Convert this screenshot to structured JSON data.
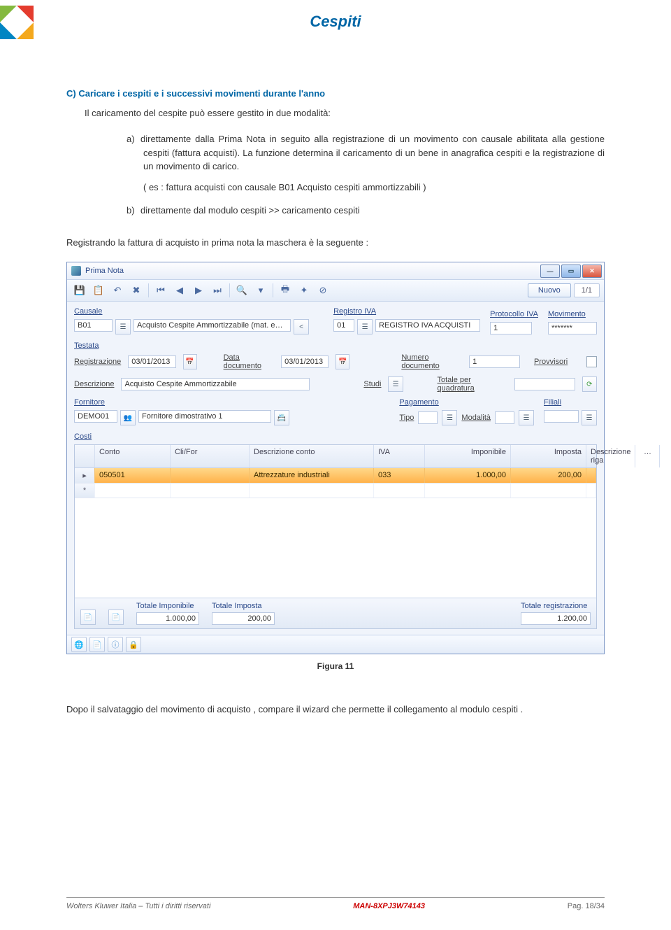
{
  "header": {
    "title": "Cespiti"
  },
  "sectionC": {
    "heading": "C)  Caricare i cespiti e i successivi movimenti durante l'anno",
    "intro": "Il caricamento del cespite può essere gestito in due modalità:"
  },
  "optA": {
    "tag": "a)",
    "text": "direttamente dalla Prima Nota in seguito alla registrazione di un movimento con causale abilitata alla gestione cespiti (fattura acquisti). La funzione determina il caricamento di un bene in anagrafica cespiti e la registrazione di un movimento di carico.",
    "example": "( es : fattura acquisti con causale B01 Acquisto cespiti ammortizzabili )"
  },
  "optB": {
    "tag": "b)",
    "text": "direttamente dal modulo cespiti >> caricamento cespiti"
  },
  "regline": "Registrando la fattura di acquisto in prima nota  la maschera è la seguente :",
  "win": {
    "title": "Prima Nota",
    "nuovo": "Nuovo",
    "counter": "1/1",
    "sect": {
      "causale": "Causale",
      "registro": "Registro IVA",
      "protocollo": "Protocollo IVA",
      "movimento": "Movimento",
      "testata": "Testata",
      "fornitore": "Fornitore",
      "pagamento": "Pagamento",
      "filiali": "Filiali",
      "costi": "Costi"
    },
    "labels": {
      "registrazione": "Registrazione",
      "datadoc": "Data documento",
      "numdoc": "Numero documento",
      "provv": "Provvisori",
      "descrizione": "Descrizione",
      "studi": "Studi",
      "totquad": "Totale per quadratura",
      "tipo": "Tipo",
      "modalita": "Modalità"
    },
    "vals": {
      "causale_cod": "B01",
      "causale_desc": "Acquisto Cespite Ammortizzabile (mat. e…",
      "reg_cod": "01",
      "reg_desc": "REGISTRO IVA ACQUISTI",
      "protocollo": "1",
      "movimento": "*******",
      "data_reg": "03/01/2013",
      "data_doc": "03/01/2013",
      "num_doc": "1",
      "descrizione": "Acquisto Cespite Ammortizzabile",
      "forn_cod": "DEMO01",
      "forn_desc": "Fornitore dimostrativo 1"
    },
    "grid": {
      "headers": {
        "conto": "Conto",
        "clifor": "Cli/For",
        "desc": "Descrizione conto",
        "iva": "IVA",
        "imponibile": "Imponibile",
        "imposta": "Imposta",
        "drig": "Descrizione riga",
        "dots": "…"
      },
      "row": {
        "conto": "050501",
        "clifor": "",
        "desc": "Attrezzature industriali",
        "iva": "033",
        "imponibile": "1.000,00",
        "imposta": "200,00",
        "drig": ""
      }
    },
    "totali": {
      "impon_lbl": "Totale Imponibile",
      "impon": "1.000,00",
      "impos_lbl": "Totale Imposta",
      "impos": "200,00",
      "reg_lbl": "Totale registrazione",
      "reg": "1.200,00"
    }
  },
  "figcap": "Figura 11",
  "aftertext": "Dopo il salvataggio del movimento di acquisto ,  compare il wizard che permette il collegamento al modulo cespiti .",
  "footer": {
    "left": "Wolters Kluwer Italia – Tutti i diritti riservati",
    "mid": "MAN-8XPJ3W74143",
    "right": "Pag.  18/34"
  }
}
